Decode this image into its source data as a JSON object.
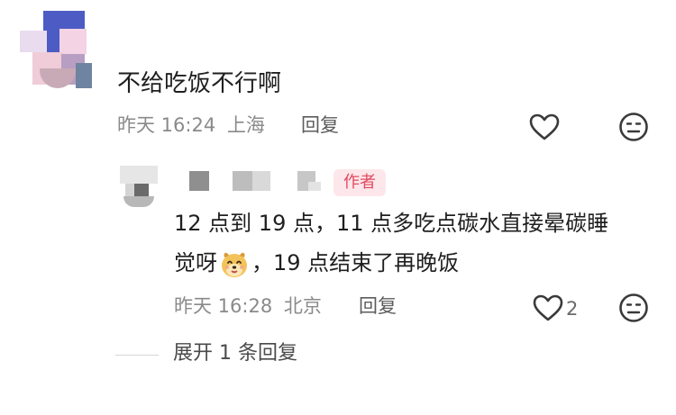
{
  "comment": {
    "text": "不给吃饭不行啊",
    "time": "昨天 16:24",
    "location": "上海",
    "reply_label": "回复"
  },
  "reply": {
    "author_badge": "作者",
    "text_line1": "12 点到 19 点，11 点多吃点碳水直接晕碳睡",
    "text_line2_a": "觉呀",
    "text_line2_b": "，19 点结束了再晚饭",
    "time": "昨天 16:28",
    "location": "北京",
    "reply_label": "回复",
    "like_count": "2"
  },
  "expand": {
    "label": "展开 1 条回复"
  },
  "icons": {
    "like": "heart-outline-icon",
    "dislike": "neutral-face-icon",
    "emoji": "smiling-dog-emoji"
  },
  "colors": {
    "author_badge_bg": "#fde7ea",
    "author_badge_text": "#e24a60",
    "meta_text": "#8a8a8a"
  }
}
